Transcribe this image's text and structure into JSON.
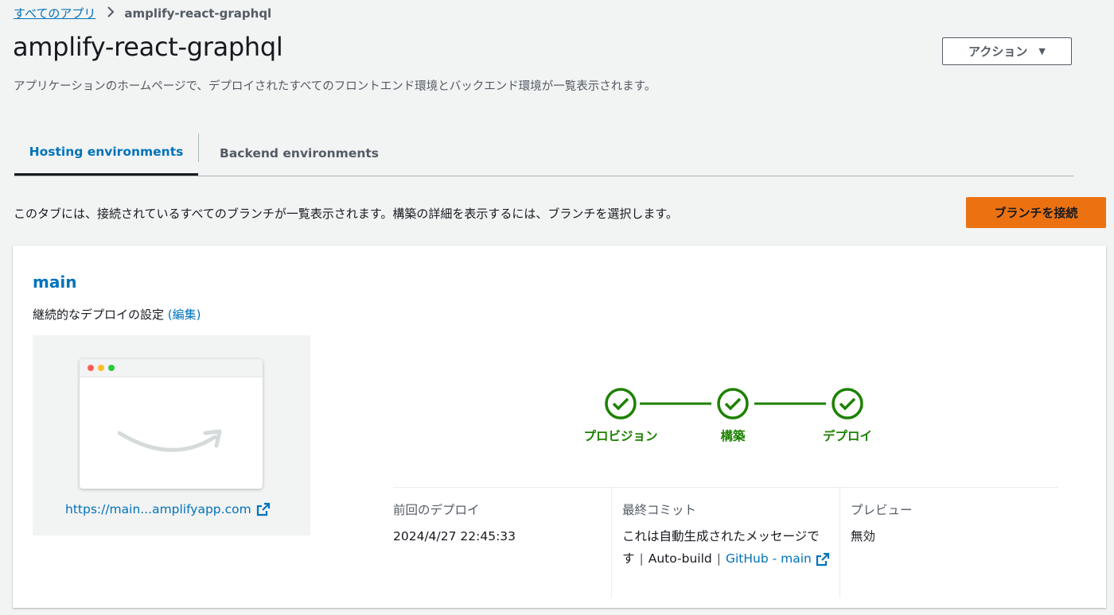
{
  "breadcrumb": {
    "root_label": "すべてのアプリ",
    "current_label": "amplify-react-graphql"
  },
  "page": {
    "title": "amplify-react-graphql",
    "subtitle": "アプリケーションのホームページで、デプロイされたすべてのフロントエンド環境とバックエンド環境が一覧表示されます。",
    "actions_label": "アクション"
  },
  "tabs": [
    {
      "label": "Hosting environments",
      "active": true
    },
    {
      "label": "Backend environments",
      "active": false
    }
  ],
  "hosting": {
    "description": "このタブには、接続されているすべてのブランチが一覧表示されます。構築の詳細を表示するには、ブランチを選択します。",
    "connect_button_label": "ブランチを接続"
  },
  "branch": {
    "name": "main",
    "cd_settings_label": "継続的なデプロイの設定",
    "edit_label": "(編集)",
    "url_label": "https://main...amplifyapp.com",
    "pipeline": [
      {
        "label": "プロビジョン",
        "status": "success"
      },
      {
        "label": "構築",
        "status": "success"
      },
      {
        "label": "デプロイ",
        "status": "success"
      }
    ],
    "last_deploy": {
      "label": "前回のデプロイ",
      "value": "2024/4/27 22:45:33"
    },
    "last_commit": {
      "label": "最終コミット",
      "message": "これは自動生成されたメッセージです",
      "source": "Auto-build",
      "repo_link": "GitHub - main"
    },
    "preview": {
      "label": "プレビュー",
      "value": "無効"
    }
  },
  "colors": {
    "link": "#0073bb",
    "primary_button": "#ec7211",
    "success": "#1d8102",
    "background": "#f2f3f3"
  }
}
